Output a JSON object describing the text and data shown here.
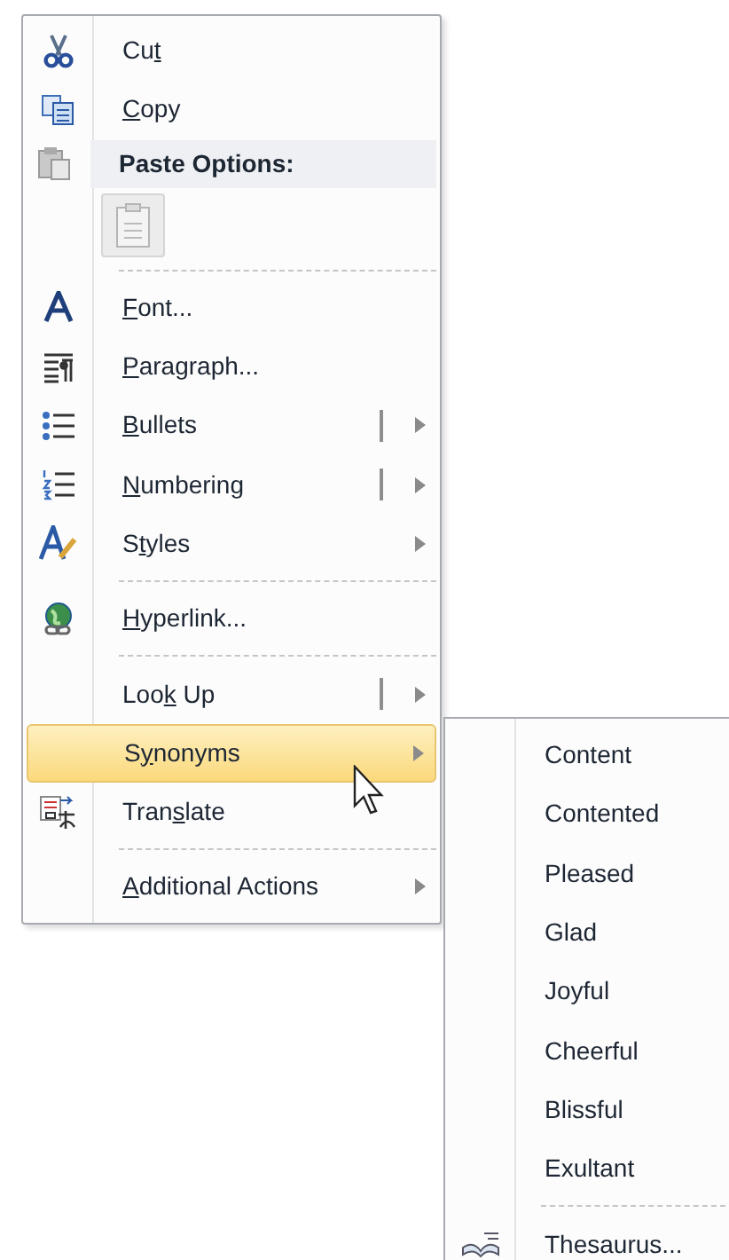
{
  "context_menu": {
    "items": [
      {
        "kind": "item",
        "label": {
          "pre": "Cu",
          "key": "t"
        },
        "has_submenu": false,
        "split": false,
        "selected": false
      },
      {
        "kind": "item",
        "label": {
          "key": "C",
          "post": "opy"
        },
        "has_submenu": false,
        "split": false,
        "selected": false
      },
      {
        "kind": "header",
        "label": {
          "pre": "Paste Options:"
        }
      },
      {
        "kind": "paste-buttons",
        "disabled": true
      },
      {
        "kind": "separator"
      },
      {
        "kind": "item",
        "label": {
          "key": "F",
          "post": "ont..."
        },
        "has_submenu": false,
        "split": false,
        "selected": false
      },
      {
        "kind": "item",
        "label": {
          "key": "P",
          "post": "aragraph..."
        },
        "has_submenu": false,
        "split": false,
        "selected": false
      },
      {
        "kind": "item",
        "label": {
          "key": "B",
          "post": "ullets"
        },
        "has_submenu": true,
        "split": true,
        "selected": false
      },
      {
        "kind": "item",
        "label": {
          "key": "N",
          "post": "umbering"
        },
        "has_submenu": true,
        "split": true,
        "selected": false
      },
      {
        "kind": "item",
        "label": {
          "pre": "S",
          "key": "t",
          "post": "yles"
        },
        "has_submenu": true,
        "split": false,
        "selected": false
      },
      {
        "kind": "separator"
      },
      {
        "kind": "item",
        "label": {
          "key": "H",
          "post": "yperlink..."
        },
        "has_submenu": false,
        "split": false,
        "selected": false
      },
      {
        "kind": "separator"
      },
      {
        "kind": "item",
        "label": {
          "pre": "Loo",
          "key": "k",
          "post": " Up"
        },
        "has_submenu": true,
        "split": true,
        "selected": false
      },
      {
        "kind": "item",
        "label": {
          "pre": "S",
          "key": "y",
          "post": "nonyms"
        },
        "has_submenu": true,
        "split": false,
        "selected": true
      },
      {
        "kind": "item",
        "label": {
          "pre": "Tran",
          "key": "s",
          "post": "late"
        },
        "has_submenu": false,
        "split": false,
        "selected": false
      },
      {
        "kind": "separator"
      },
      {
        "kind": "item",
        "label": {
          "key": "A",
          "post": "dditional Actions"
        },
        "has_submenu": true,
        "split": false,
        "selected": false
      }
    ]
  },
  "synonyms_submenu": {
    "items": [
      {
        "kind": "item",
        "label": {
          "pre": "Content"
        }
      },
      {
        "kind": "item",
        "label": {
          "pre": "Contented"
        }
      },
      {
        "kind": "item",
        "label": {
          "pre": "Pleased"
        }
      },
      {
        "kind": "item",
        "label": {
          "pre": "Glad"
        }
      },
      {
        "kind": "item",
        "label": {
          "pre": "Joyful"
        }
      },
      {
        "kind": "item",
        "label": {
          "pre": "Cheerful"
        }
      },
      {
        "kind": "item",
        "label": {
          "pre": "Blissful"
        }
      },
      {
        "kind": "item",
        "label": {
          "pre": "Exultant"
        }
      },
      {
        "kind": "separator"
      },
      {
        "kind": "item",
        "label": {
          "pre": "Thesaurus..."
        }
      }
    ]
  }
}
